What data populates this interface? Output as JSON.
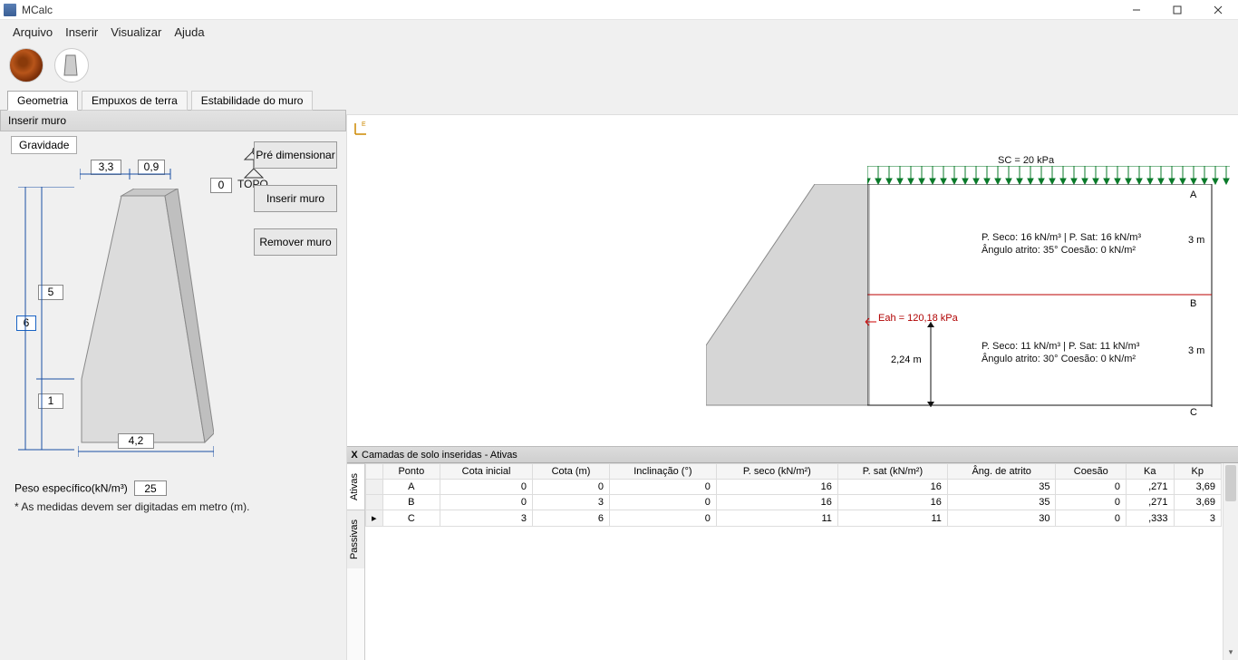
{
  "app": {
    "title": "MCalc"
  },
  "menu": [
    "Arquivo",
    "Inserir",
    "Visualizar",
    "Ajuda"
  ],
  "tabs": {
    "t0": "Geometria",
    "t1": "Empuxos de terra",
    "t2": "Estabilidade do muro"
  },
  "subheader": "Inserir muro",
  "subtab": "Gravidade",
  "actions": {
    "pre": "Pré dimensionar",
    "ins": "Inserir muro",
    "rem": "Remover muro"
  },
  "geom": {
    "d_3_3": "3,3",
    "d_0_9": "0,9",
    "d_0a": "0",
    "d_0b": "0",
    "topo": "TOPO",
    "h6": "6",
    "h5": "5",
    "h1": "1",
    "w4_2": "4,2",
    "peso_label": "Peso específico(kN/m³)",
    "peso_val": "25",
    "note": "* As medidas devem ser digitadas em metro (m)."
  },
  "diagram": {
    "sc": "SC = 20 kPa",
    "layerA": {
      "line1": "P. Seco: 16 kN/m³ | P. Sat: 16 kN/m³",
      "line2": "Ângulo atrito: 35° Coesão: 0 kN/m²",
      "h": "3 m",
      "pt": "A"
    },
    "layerB": {
      "line1": "P. Seco: 11 kN/m³ | P. Sat: 11 kN/m³",
      "line2": "Ângulo atrito: 30° Coesão: 0 kN/m²",
      "h": "3 m",
      "pt": "B",
      "eah": "Eah = 120,18 kPa",
      "mid": "2,24 m"
    },
    "ptC": "C"
  },
  "soil": {
    "title": "Camadas de solo inseridas - Ativas",
    "close": "X",
    "sidetabs": [
      "Ativas",
      "Passivas"
    ],
    "headers": [
      "",
      "Ponto",
      "Cota inicial",
      "Cota (m)",
      "Inclinação (°)",
      "P. seco (kN/m²)",
      "P. sat (kN/m²)",
      "Âng. de atrito",
      "Coesão",
      "Ka",
      "Kp"
    ],
    "rows": [
      {
        "mark": "",
        "p": "A",
        "ci": "0",
        "c": "0",
        "inc": "0",
        "ps": "16",
        "psat": "16",
        "ang": "35",
        "coe": "0",
        "ka": ",271",
        "kp": "3,69"
      },
      {
        "mark": "",
        "p": "B",
        "ci": "0",
        "c": "3",
        "inc": "0",
        "ps": "16",
        "psat": "16",
        "ang": "35",
        "coe": "0",
        "ka": ",271",
        "kp": "3,69"
      },
      {
        "mark": "▸",
        "p": "C",
        "ci": "3",
        "c": "6",
        "inc": "0",
        "ps": "11",
        "psat": "11",
        "ang": "30",
        "coe": "0",
        "ka": ",333",
        "kp": "3"
      }
    ]
  }
}
